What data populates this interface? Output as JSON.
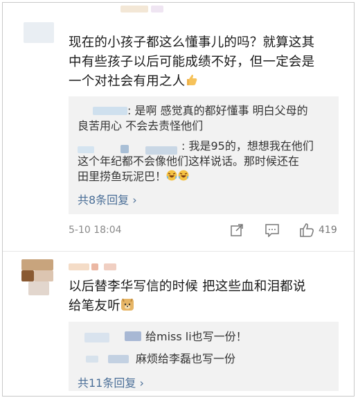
{
  "comment1": {
    "text_lines": [
      "现在的小孩子都这么懂事儿的吗？就算这其",
      "中有些孩子以后可能成绩不好，但一定会是",
      "一个对社会有用之人"
    ],
    "replies": [
      {
        "lines": [
          ": 是啊 感觉真的都好懂事 明白父母的",
          "良苦用心 不会去责怪他们"
        ]
      },
      {
        "lines": [
          ": 我是95的，想想我在他们",
          "这个年纪都不会像他们这样说话。那时候还在",
          "田里捞鱼玩泥巴！"
        ]
      }
    ],
    "more_replies": "共8条回复 ›",
    "time": "5-10 18:04",
    "like_count": "419"
  },
  "comment2": {
    "text_lines": [
      "以后替李华写信的时候 把这些血和泪都说",
      "给笔友听"
    ],
    "replies": [
      {
        "text": "给miss li也写一份！"
      },
      {
        "text": "麻烦给李磊也写一份"
      }
    ],
    "more_replies": "共11条回复 ›"
  }
}
